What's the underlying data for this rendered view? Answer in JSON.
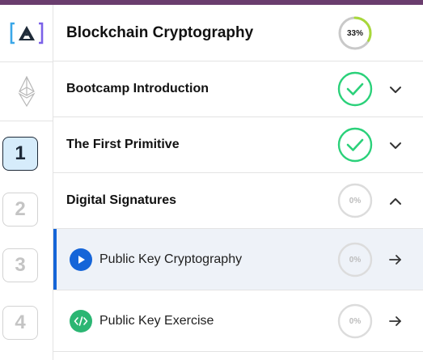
{
  "course": {
    "title": "Blockchain Cryptography",
    "progress_label": "33%",
    "progress_fraction": 0.33
  },
  "rail": {
    "logo_icon": "alchemy-logo-icon",
    "eth_icon": "ethereum-icon",
    "units": [
      {
        "label": "1",
        "state": "active"
      },
      {
        "label": "2",
        "state": "inactive"
      },
      {
        "label": "3",
        "state": "inactive"
      },
      {
        "label": "4",
        "state": "inactive"
      }
    ]
  },
  "sections": [
    {
      "title": "Bootcamp Introduction",
      "status": "complete",
      "chevron": "chevron-down-icon"
    },
    {
      "title": "The First Primitive",
      "status": "complete",
      "chevron": "chevron-down-icon"
    },
    {
      "title": "Digital Signatures",
      "status": "in-progress",
      "progress_label": "0%",
      "chevron": "chevron-up-icon"
    }
  ],
  "lessons": [
    {
      "title": "Public Key Cryptography",
      "icon": "play-icon",
      "icon_color": "#1565d8",
      "progress_label": "0%",
      "active": true
    },
    {
      "title": "Public Key Exercise",
      "icon": "code-icon",
      "icon_color": "#2bb673",
      "progress_label": "0%",
      "active": false
    }
  ],
  "colors": {
    "top_bar": "#6a3d6e",
    "complete_green": "#2bd17a",
    "progress_green": "#a8d83a",
    "active_blue": "#1565d8",
    "active_unit_bg": "#d6ecfb"
  }
}
